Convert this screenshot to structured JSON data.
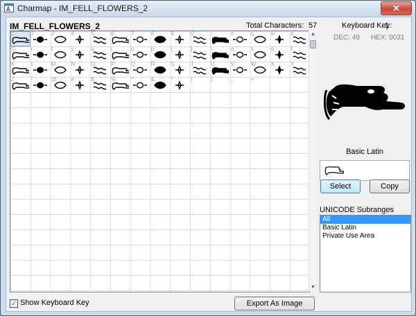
{
  "window": {
    "title": "Charmap - IM_FELL_FLOWERS_2",
    "close_glyph": "✕"
  },
  "font": {
    "name": "IM_FELL_FLOWERS_2"
  },
  "totals": {
    "label": "Total Characters:",
    "value": "57"
  },
  "keyboard": {
    "label": "Keyboard Key:",
    "value": "1",
    "dec": "DEC: 49",
    "hex": "HEX: 0031"
  },
  "grid": {
    "rows": [
      [
        "1",
        "2",
        "3",
        "4",
        "5",
        "6",
        "7",
        "8",
        "9",
        "0",
        "-",
        "=",
        "q",
        "w",
        "e"
      ],
      [
        "Q",
        "r",
        "t",
        "y",
        "u",
        "i",
        "o",
        "p",
        "[",
        "]",
        "\\",
        "a",
        "s",
        "d",
        "f"
      ],
      [
        "K",
        "L",
        "M",
        "N",
        "O",
        "P",
        "Q",
        "R",
        "S",
        "T",
        "U",
        "V",
        "W",
        "X",
        "Y"
      ],
      [
        "Z",
        "!",
        "@",
        "#",
        "$",
        "%",
        "^",
        "&",
        "*",
        "(",
        ")",
        "_",
        "+",
        "",
        ""
      ],
      [
        "",
        "",
        "",
        "",
        "",
        "",
        "",
        "",
        "",
        "",
        "",
        "",
        "",
        "",
        ""
      ]
    ]
  },
  "preview": {
    "subrange": "Basic Latin"
  },
  "buttons": {
    "select": "Select",
    "copy": "Copy",
    "export": "Export As Image"
  },
  "subranges": {
    "label": "UNICODE Subranges",
    "items": [
      "All",
      "Basic Latin",
      "Private Use Area"
    ],
    "selected": "All"
  },
  "show_key": {
    "label": "Show Keyboard Key",
    "checked": true,
    "check_glyph": "✓"
  },
  "scroll": {
    "up_glyph": "▲",
    "down_glyph": "▼"
  }
}
